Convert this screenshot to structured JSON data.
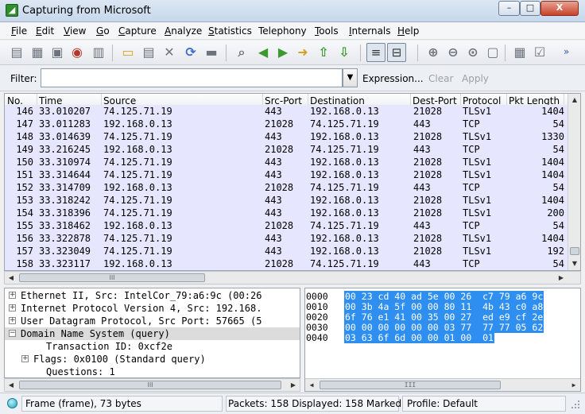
{
  "window": {
    "title": "Capturing from Microsoft",
    "icon": "shark-fin-icon"
  },
  "window_buttons": {
    "minimize": "–",
    "maximize": "□",
    "close": "X"
  },
  "menu": [
    {
      "label": "File",
      "u": "F",
      "rest": "ile"
    },
    {
      "label": "Edit",
      "u": "E",
      "rest": "dit"
    },
    {
      "label": "View",
      "u": "V",
      "rest": "iew"
    },
    {
      "label": "Go",
      "u": "G",
      "rest": "o"
    },
    {
      "label": "Capture",
      "u": "C",
      "rest": "apture"
    },
    {
      "label": "Analyze",
      "u": "A",
      "rest": "nalyze"
    },
    {
      "label": "Statistics",
      "u": "S",
      "rest": "tatistics"
    },
    {
      "label": "Telephony",
      "u": "",
      "rest": "Telephony"
    },
    {
      "label": "Tools",
      "u": "T",
      "rest": "ools"
    },
    {
      "label": "Internals",
      "u": "I",
      "rest": "nternals"
    },
    {
      "label": "Help",
      "u": "H",
      "rest": "elp"
    }
  ],
  "toolbar": {
    "icons": [
      "interface-list-icon",
      "capture-options-icon",
      "start-capture-icon",
      "stop-capture-icon",
      "restart-capture-icon",
      "open-file-icon",
      "save-file-icon",
      "close-file-icon",
      "reload-icon",
      "print-icon",
      "find-packet-icon",
      "go-back-icon",
      "go-forward-icon",
      "go-to-packet-icon",
      "go-first-icon",
      "go-last-icon",
      "colorize-icon",
      "auto-scroll-icon",
      "zoom-in-icon",
      "zoom-out-icon",
      "zoom-normal-icon",
      "resize-columns-icon",
      "capture-filters-icon",
      "display-filters-icon"
    ],
    "more": "»",
    "colors": {
      "green": "#3a9a2e",
      "blue": "#3f6fc7",
      "red": "#b5392b",
      "gray": "#6c737c",
      "yellow": "#d6a21e"
    }
  },
  "filter": {
    "label": "Filter:",
    "value": "",
    "dropdown": "▼",
    "expression": "Expression...",
    "clear": "Clear",
    "apply": "Apply"
  },
  "packet_list": {
    "columns": [
      "No.",
      "Time",
      "Source",
      "Src-Port",
      "Destination",
      "Dest-Port",
      "Protocol",
      "Pkt Length"
    ],
    "rows": [
      {
        "no": "146",
        "time": "33.010207",
        "src": "74.125.71.19",
        "sport": "443",
        "dst": "192.168.0.13",
        "dport": "21028",
        "proto": "TLSv1",
        "len": "1404"
      },
      {
        "no": "147",
        "time": "33.011283",
        "src": "192.168.0.13",
        "sport": "21028",
        "dst": "74.125.71.19",
        "dport": "443",
        "proto": "TCP",
        "len": "54"
      },
      {
        "no": "148",
        "time": "33.014639",
        "src": "74.125.71.19",
        "sport": "443",
        "dst": "192.168.0.13",
        "dport": "21028",
        "proto": "TLSv1",
        "len": "1330"
      },
      {
        "no": "149",
        "time": "33.216245",
        "src": "192.168.0.13",
        "sport": "21028",
        "dst": "74.125.71.19",
        "dport": "443",
        "proto": "TCP",
        "len": "54"
      },
      {
        "no": "150",
        "time": "33.310974",
        "src": "74.125.71.19",
        "sport": "443",
        "dst": "192.168.0.13",
        "dport": "21028",
        "proto": "TLSv1",
        "len": "1404"
      },
      {
        "no": "151",
        "time": "33.314644",
        "src": "74.125.71.19",
        "sport": "443",
        "dst": "192.168.0.13",
        "dport": "21028",
        "proto": "TLSv1",
        "len": "1404"
      },
      {
        "no": "152",
        "time": "33.314709",
        "src": "192.168.0.13",
        "sport": "21028",
        "dst": "74.125.71.19",
        "dport": "443",
        "proto": "TCP",
        "len": "54"
      },
      {
        "no": "153",
        "time": "33.318242",
        "src": "74.125.71.19",
        "sport": "443",
        "dst": "192.168.0.13",
        "dport": "21028",
        "proto": "TLSv1",
        "len": "1404"
      },
      {
        "no": "154",
        "time": "33.318396",
        "src": "74.125.71.19",
        "sport": "443",
        "dst": "192.168.0.13",
        "dport": "21028",
        "proto": "TLSv1",
        "len": "200"
      },
      {
        "no": "155",
        "time": "33.318462",
        "src": "192.168.0.13",
        "sport": "21028",
        "dst": "74.125.71.19",
        "dport": "443",
        "proto": "TCP",
        "len": "54"
      },
      {
        "no": "156",
        "time": "33.322878",
        "src": "74.125.71.19",
        "sport": "443",
        "dst": "192.168.0.13",
        "dport": "21028",
        "proto": "TLSv1",
        "len": "1404"
      },
      {
        "no": "157",
        "time": "33.323049",
        "src": "74.125.71.19",
        "sport": "443",
        "dst": "192.168.0.13",
        "dport": "21028",
        "proto": "TLSv1",
        "len": "192"
      },
      {
        "no": "158",
        "time": "33.323117",
        "src": "192.168.0.13",
        "sport": "21028",
        "dst": "74.125.71.19",
        "dport": "443",
        "proto": "TCP",
        "len": "54"
      }
    ],
    "scroll_thumb_label": "III"
  },
  "details": {
    "rows": [
      {
        "expander": "+",
        "indent": 0,
        "text": "Ethernet II, Src: IntelCor_79:a6:9c (00:26"
      },
      {
        "expander": "+",
        "indent": 0,
        "text": "Internet Protocol Version 4, Src: 192.168."
      },
      {
        "expander": "+",
        "indent": 0,
        "text": "User Datagram Protocol, Src Port: 57665 (5"
      },
      {
        "expander": "−",
        "indent": 0,
        "text": "Domain Name System (query)"
      },
      {
        "expander": "",
        "indent": 2,
        "text": "Transaction ID: 0xcf2e"
      },
      {
        "expander": "+",
        "indent": 1,
        "text": "Flags: 0x0100 (Standard query)"
      },
      {
        "expander": "",
        "indent": 2,
        "text": "Questions: 1"
      }
    ],
    "scroll_thumb_label": "III"
  },
  "bytes": {
    "rows": [
      {
        "offset": "0000",
        "hex": "00 23 cd 40 ad 5e 00 26  c7 79 a6 9c"
      },
      {
        "offset": "0010",
        "hex": "00 3b 4a 5f 00 00 80 11  4b 43 c0 a8"
      },
      {
        "offset": "0020",
        "hex": "6f 76 e1 41 00 35 00 27  ed e9 cf 2e"
      },
      {
        "offset": "0030",
        "hex": "00 00 00 00 00 00 03 77  77 77 05 62"
      },
      {
        "offset": "0040",
        "hex": "03 63 6f 6d 00 00 01 00  01"
      }
    ],
    "highlight": "#2f8ff0",
    "scroll_thumb_label": "III"
  },
  "status": {
    "frame": "Frame (frame), 73 bytes",
    "packets": "Packets: 158 Displayed: 158 Marked: 0",
    "profile": "Profile: Default"
  }
}
